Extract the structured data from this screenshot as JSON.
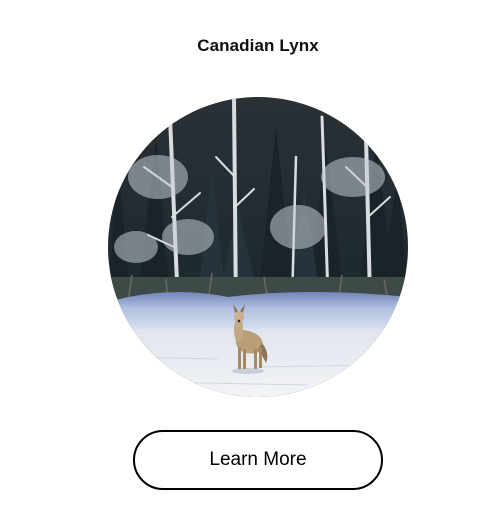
{
  "card": {
    "title": "Canadian Lynx",
    "image_subject": "wild canine standing on a snowy frozen lake in front of a winter forest",
    "button_label": "Learn More"
  },
  "colors": {
    "text": "#111111",
    "button_border": "#000000",
    "background": "#ffffff"
  }
}
